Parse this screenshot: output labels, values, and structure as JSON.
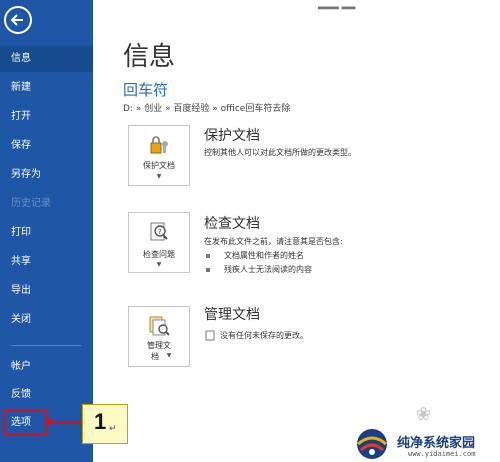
{
  "sidebar": {
    "items": [
      {
        "label": "信息",
        "active": true
      },
      {
        "label": "新建"
      },
      {
        "label": "打开"
      },
      {
        "label": "保存"
      },
      {
        "label": "另存为"
      },
      {
        "label": "历史记录",
        "disabled": true
      },
      {
        "label": "打印"
      },
      {
        "label": "共享"
      },
      {
        "label": "导出"
      },
      {
        "label": "关闭"
      },
      {
        "label": "帐户"
      },
      {
        "label": "反馈"
      },
      {
        "label": "选项"
      }
    ]
  },
  "callout": {
    "number": "1",
    "mark": "↵"
  },
  "main": {
    "title": "信息",
    "doc_name": "回车符",
    "path": "D: » 创业 » 百度经验 » office回车符去除",
    "protect": {
      "tile_label": "保护文档",
      "title": "保护文档",
      "desc": "控制其他人可以对此文档所做的更改类型。"
    },
    "inspect": {
      "tile_label": "检查问题",
      "title": "检查文档",
      "desc": "在发布此文件之前，请注意其是否包含:",
      "bullets": [
        "文档属性和作者的姓名",
        "残疾人士无法阅读的内容"
      ]
    },
    "manage": {
      "tile_label_1": "管理文",
      "tile_label_2": "档",
      "title": "管理文档",
      "desc": "没有任何未保存的更改。"
    }
  },
  "watermark": {
    "text": "纯净系统家园",
    "url": "www.yidaimei.com"
  },
  "colors": {
    "sidebar": "#1f56a5",
    "accent": "#2b6cc4",
    "callout_border": "#d80f1e",
    "callout_fill": "#fff9c4"
  }
}
